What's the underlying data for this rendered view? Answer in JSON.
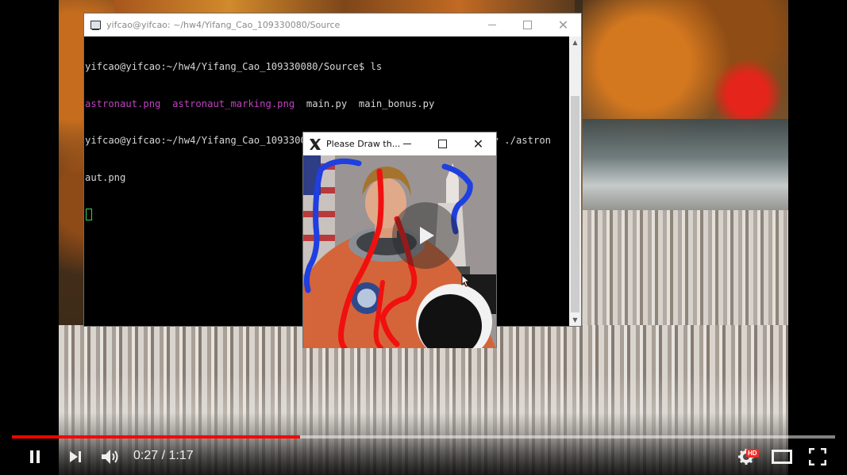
{
  "terminal": {
    "title": "yifcao@yifcao: ~/hw4/Yifang_Cao_109330080/Source",
    "lines": {
      "l1": "yifcao@yifcao:~/hw4/Yifang_Cao_109330080/Source$ ls",
      "l2a": "astronaut.png",
      "l2b": "astronaut_marking.png",
      "l2c": "main.py  main_bonus.py",
      "l3": "yifcao@yifcao:~/hw4/Yifang_Cao_109330080/Source$ python ./main_bonus.py ./astron",
      "l4": "aut.png"
    },
    "colors": {
      "background": "#000000",
      "text": "#d6d6d6",
      "highlight": "#c042c0",
      "cursor": "#39d353"
    }
  },
  "image_window": {
    "title": "Please Draw th...",
    "icon": "x11-icon"
  },
  "player": {
    "current_time": "0:27",
    "separator": "/",
    "duration": "1:17",
    "time_display": "0:27 / 1:17",
    "progress_fraction": 0.35,
    "loaded_fraction": 1.0,
    "hd_badge": "HD",
    "accent_color": "#ff0000"
  },
  "icons": {
    "pause": "pause-icon",
    "next": "next-icon",
    "volume": "volume-icon",
    "settings": "gear-icon",
    "theater": "theater-mode-icon",
    "fullscreen": "fullscreen-icon",
    "play_overlay": "play-icon"
  }
}
